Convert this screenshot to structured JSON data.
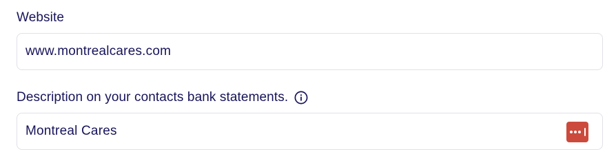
{
  "website": {
    "label": "Website",
    "value": "www.montrealcares.com"
  },
  "descriptor": {
    "label": "Description on your contacts bank statements.",
    "value": "Montreal Cares",
    "info_icon": "info-circle-icon",
    "password_manager_icon": "lastpass-dots-icon"
  },
  "colors": {
    "text": "#17145a",
    "border": "#e1e1e8",
    "password_manager_bg": "#cc4a3c"
  }
}
